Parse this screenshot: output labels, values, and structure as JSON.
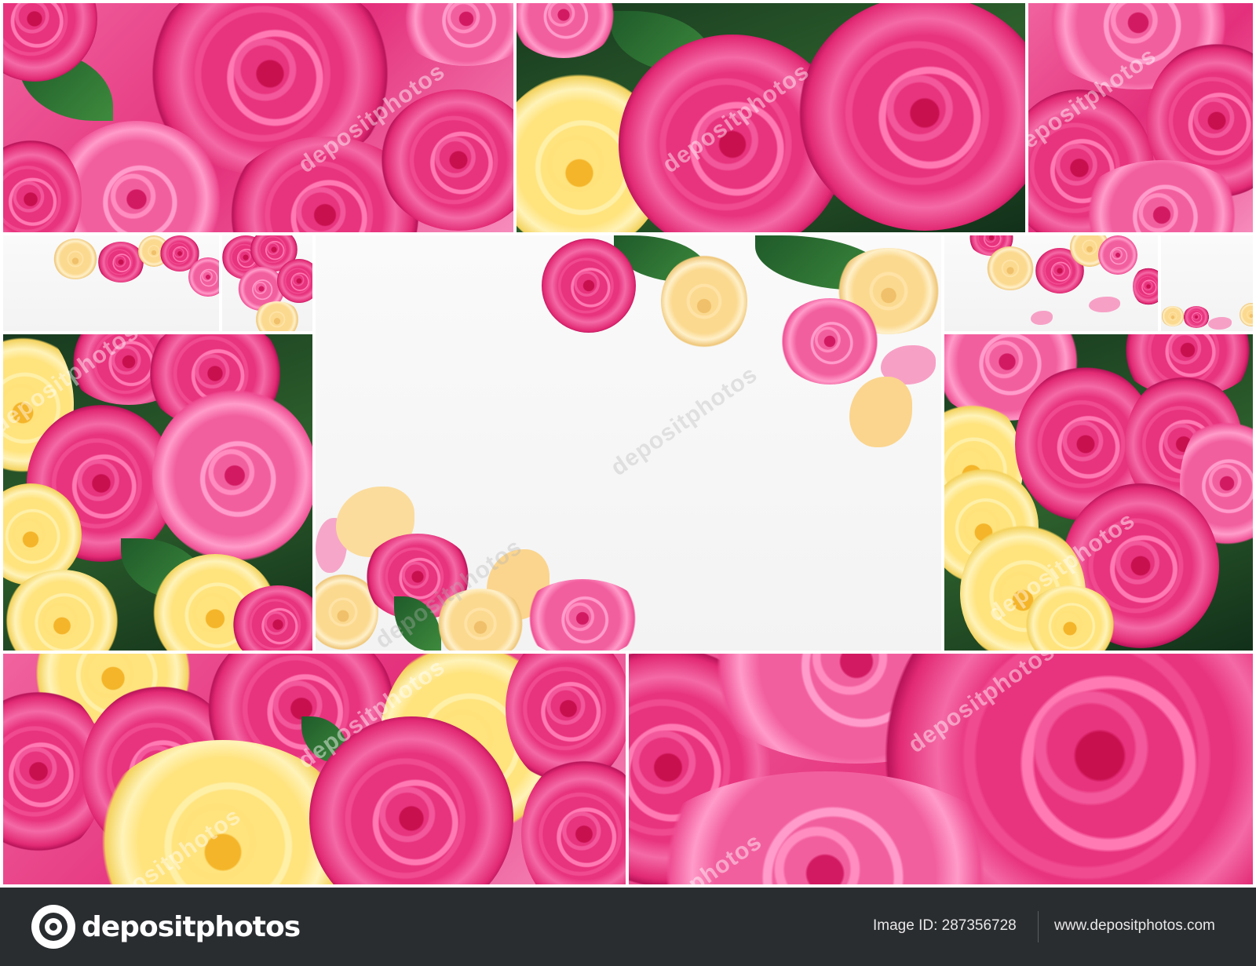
{
  "watermark": {
    "text": "depositphotos",
    "fragment": "photos"
  },
  "footer": {
    "logo_text": "depositphotos",
    "image_id": "Image ID: 287356728",
    "site_url": "www.depositphotos.com",
    "background": "#2a2d30"
  },
  "colors": {
    "pink": "#e8337e",
    "yellow": "#ffe37d",
    "peach": "#fbd98f",
    "leaf": "#2d5f2c"
  }
}
